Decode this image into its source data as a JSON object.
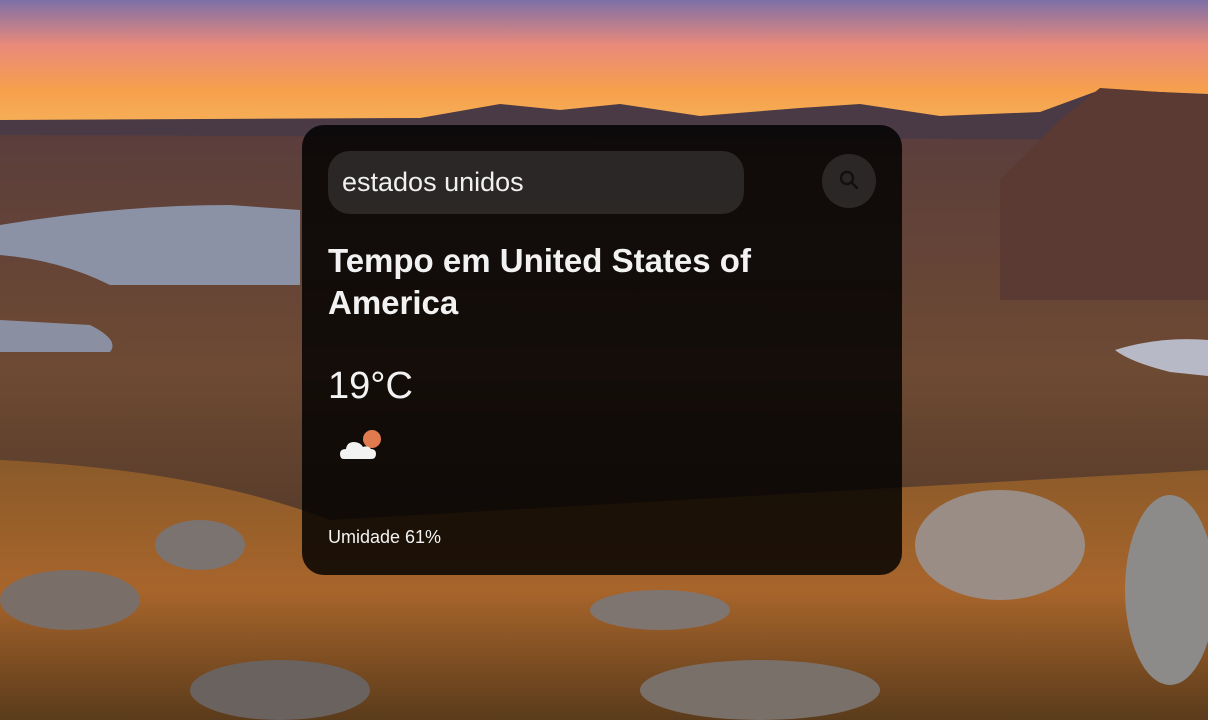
{
  "search": {
    "value": "estados unidos"
  },
  "weather": {
    "city_title": "Tempo em United States of America",
    "temperature": "19°C",
    "humidity": "Umidade 61%",
    "condition_icon": "partly-cloudy-icon"
  },
  "colors": {
    "card_background": "#000000",
    "text": "#f2f2f2",
    "sun": "#e07a4f"
  }
}
